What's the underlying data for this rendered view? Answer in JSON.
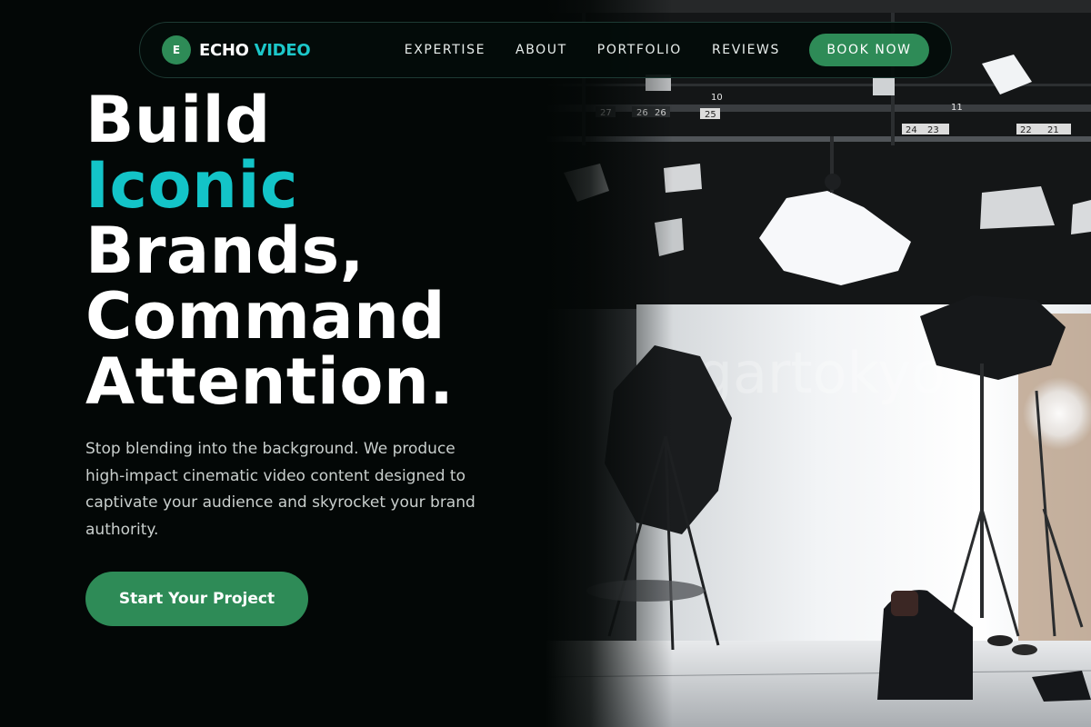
{
  "brand": {
    "mark": "E",
    "name_part1": "ECHO",
    "name_part2": "VIDEO"
  },
  "nav": {
    "links": [
      "EXPERTISE",
      "ABOUT",
      "PORTFOLIO",
      "REVIEWS"
    ],
    "cta_label": "BOOK NOW"
  },
  "hero": {
    "headline": [
      "Build",
      "Iconic",
      "Brands,",
      "Command",
      "Attention."
    ],
    "description": "Stop blending into the background. We produce high-impact cinematic video content designed to captivate your audience and skyrocket your brand authority.",
    "cta_label": "Start Your Project"
  },
  "photo": {
    "studio_numbers": [
      "27",
      "26",
      "26",
      "25",
      "10",
      "11",
      "24",
      "23",
      "22",
      "21"
    ],
    "watermark": "sugartokyo"
  },
  "colors": {
    "background": "#030706",
    "accent_green": "#2e8b57",
    "accent_teal": "#13c4c8",
    "body_text": "#c9cfcd"
  },
  "icons": {
    "brand_mark": "circle-letter-icon"
  }
}
